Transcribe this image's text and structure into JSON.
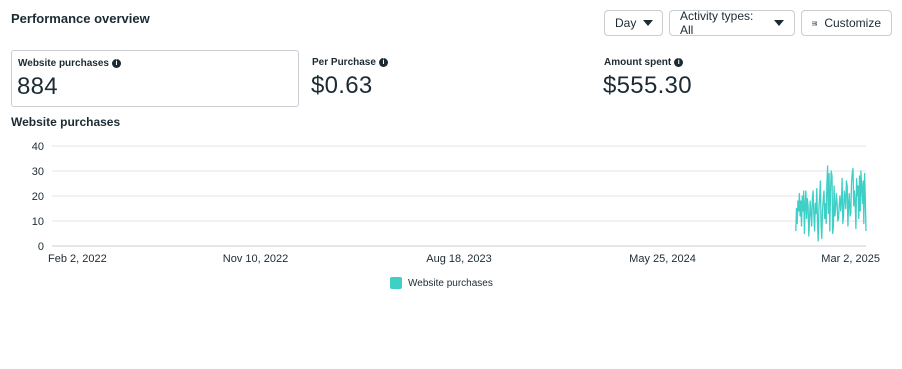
{
  "header": {
    "title": "Performance overview",
    "day_label": "Day",
    "activity_label": "Activity types: All",
    "customize_label": "Customize"
  },
  "cards": [
    {
      "label": "Website purchases",
      "value": "884"
    },
    {
      "label": "Per Purchase",
      "value": "$0.63"
    },
    {
      "label": "Amount spent",
      "value": "$555.30"
    }
  ],
  "chart_title": "Website purchases",
  "colors": {
    "series": "#3ecfc6",
    "grid": "#e4e6eb",
    "text": "#1c2b33"
  },
  "chart_data": {
    "type": "line",
    "title": "Website purchases",
    "xlabel": "",
    "ylabel": "",
    "ylim": [
      0,
      40
    ],
    "grid": true,
    "legend": "bottom-center",
    "x_tick_labels": [
      "Feb 2, 2022",
      "Nov 10, 2022",
      "Aug 18, 2023",
      "May 25, 2024",
      "Mar 2, 2025"
    ],
    "y_tick_labels": [
      "0",
      "10",
      "20",
      "30",
      "40"
    ],
    "series": [
      {
        "name": "Website purchases",
        "x": [
          "2024-11-25",
          "2024-11-26",
          "2024-11-27",
          "2024-11-28",
          "2024-11-29",
          "2024-11-30",
          "2024-12-01",
          "2024-12-02",
          "2024-12-03",
          "2024-12-04",
          "2024-12-05",
          "2024-12-06",
          "2024-12-07",
          "2024-12-08",
          "2024-12-09",
          "2024-12-10",
          "2024-12-11",
          "2024-12-12",
          "2024-12-13",
          "2024-12-14",
          "2024-12-15",
          "2024-12-16",
          "2024-12-17",
          "2024-12-18",
          "2024-12-19",
          "2024-12-20",
          "2024-12-21",
          "2024-12-22",
          "2024-12-23",
          "2024-12-24",
          "2024-12-25",
          "2024-12-26",
          "2024-12-27",
          "2024-12-28",
          "2024-12-29",
          "2024-12-30",
          "2024-12-31",
          "2025-01-01",
          "2025-01-02",
          "2025-01-03",
          "2025-01-04",
          "2025-01-05",
          "2025-01-06",
          "2025-01-07",
          "2025-01-08",
          "2025-01-09",
          "2025-01-10",
          "2025-01-11",
          "2025-01-12",
          "2025-01-13",
          "2025-01-14",
          "2025-01-15",
          "2025-01-16",
          "2025-01-17",
          "2025-01-18",
          "2025-01-19",
          "2025-01-20",
          "2025-01-21",
          "2025-01-22",
          "2025-01-23",
          "2025-01-24",
          "2025-01-25",
          "2025-01-26",
          "2025-01-27",
          "2025-01-28",
          "2025-01-29",
          "2025-01-30",
          "2025-01-31",
          "2025-02-01",
          "2025-02-02",
          "2025-02-03",
          "2025-02-04",
          "2025-02-05",
          "2025-02-06",
          "2025-02-07",
          "2025-02-08",
          "2025-02-09",
          "2025-02-10",
          "2025-02-11",
          "2025-02-12",
          "2025-02-13",
          "2025-02-14",
          "2025-02-15",
          "2025-02-16",
          "2025-02-17",
          "2025-02-18",
          "2025-02-19",
          "2025-02-20",
          "2025-02-21",
          "2025-02-22",
          "2025-02-23",
          "2025-02-24",
          "2025-02-25",
          "2025-02-26",
          "2025-02-27",
          "2025-02-28",
          "2025-03-01",
          "2025-03-02"
        ],
        "values": [
          6,
          15,
          9,
          18,
          14,
          21,
          12,
          18,
          8,
          20,
          14,
          22,
          5,
          17,
          22,
          11,
          19,
          16,
          4,
          10,
          18,
          13,
          8,
          19,
          22,
          12,
          6,
          17,
          13,
          23,
          9,
          2,
          15,
          20,
          26,
          8,
          3,
          14,
          19,
          22,
          11,
          17,
          9,
          25,
          32,
          13,
          29,
          6,
          22,
          30,
          28,
          5,
          8,
          24,
          12,
          15,
          21,
          18,
          10,
          11,
          16,
          20,
          14,
          18,
          27,
          9,
          12,
          22,
          19,
          15,
          26,
          24,
          8,
          17,
          21,
          12,
          13,
          25,
          29,
          31,
          16,
          22,
          18,
          7,
          27,
          20,
          24,
          11,
          28,
          14,
          30,
          23,
          17,
          26,
          9,
          29,
          19,
          6
        ]
      }
    ]
  }
}
